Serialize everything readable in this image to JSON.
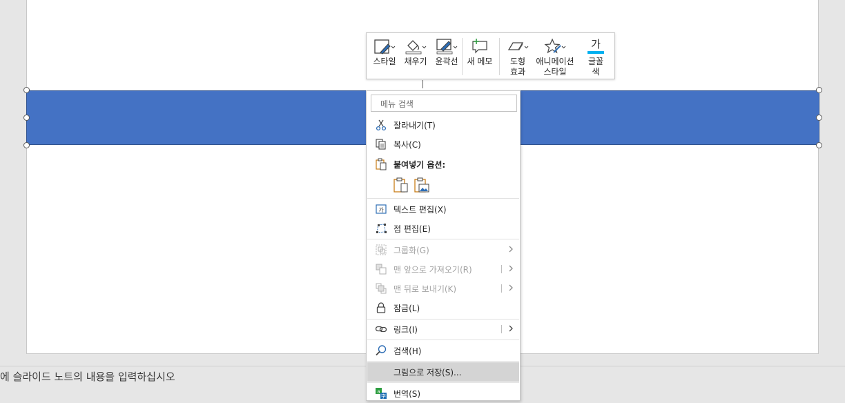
{
  "notes": {
    "placeholder": "에 슬라이드 노트의 내용을 입력하십시오"
  },
  "colors": {
    "shape_fill": "#4472c4",
    "font_color_bar": "#00b0f0",
    "accent_green": "#2e9e41",
    "accent_blue": "#1f6fb5"
  },
  "mini_toolbar": {
    "style": "스타일",
    "fill": "채우기",
    "outline": "윤곽선",
    "new_comment": "새 메모",
    "shape_effects_1": "도형",
    "shape_effects_2": "효과",
    "animation_1": "애니메이션",
    "animation_2": "스타일",
    "font_color_glyph": "가",
    "font_color_1": "글꼴",
    "font_color_2": "색"
  },
  "context_menu": {
    "search_placeholder": "메뉴 검색",
    "cut": "잘라내기(T)",
    "copy": "복사(C)",
    "paste_options": "붙여넣기 옵션:",
    "edit_text": "텍스트 편집(X)",
    "edit_points": "점 편집(E)",
    "group": "그룹화(G)",
    "bring_to_front": "맨 앞으로 가져오기(R)",
    "send_to_back": "맨 뒤로 보내기(K)",
    "lock": "잠금(L)",
    "link": "링크(I)",
    "search": "검색(H)",
    "save_as_picture": "그림으로 저장(S)...",
    "translate": "번역(S)"
  }
}
